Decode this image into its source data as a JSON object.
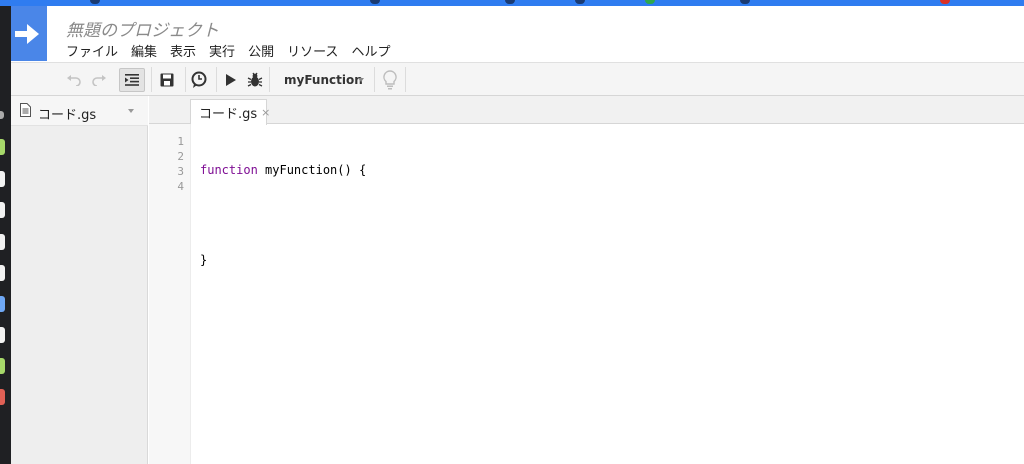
{
  "app": {
    "project_title": "無題のプロジェクト"
  },
  "menu": [
    "ファイル",
    "編集",
    "表示",
    "実行",
    "公開",
    "リソース",
    "ヘルプ"
  ],
  "toolbar": {
    "function_name": "myFunction",
    "icons": [
      "undo-icon",
      "redo-icon",
      "indent-icon",
      "save-icon",
      "triggers-clock-icon",
      "run-icon",
      "debug-bug-icon",
      "lightbulb-icon"
    ]
  },
  "sidebar": {
    "files": [
      {
        "name": "コード.gs",
        "icon": "document-icon"
      }
    ]
  },
  "editor": {
    "tab_label": "コード.gs",
    "tab_close": "×",
    "line_numbers": [
      "1",
      "2",
      "3",
      "4"
    ],
    "code_lines": [
      {
        "kw": "function",
        "rest": " myFunction() {"
      },
      {
        "kw": "",
        "rest": ""
      },
      {
        "kw": "",
        "rest": "}"
      },
      {
        "kw": "",
        "rest": ""
      }
    ]
  },
  "colors": {
    "brand_blue": "#4a86e8",
    "keyword": "#7f0e94"
  }
}
